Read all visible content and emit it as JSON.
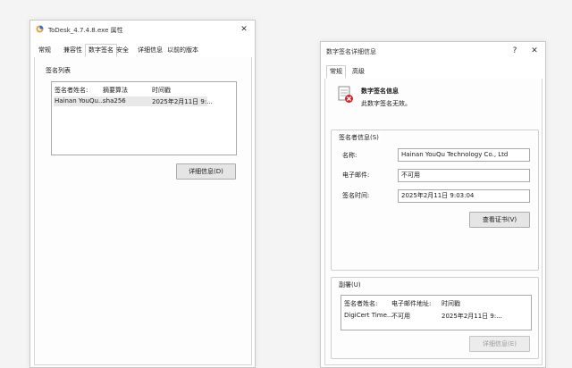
{
  "left_window": {
    "title": "ToDesk_4.7.4.8.exe 属性",
    "close_glyph": "✕",
    "tabs": [
      "常规",
      "兼容性",
      "数字签名",
      "安全",
      "详细信息",
      "以前的版本"
    ],
    "active_tab": "数字签名",
    "signature_list": {
      "label": "签名列表",
      "columns": [
        "签名者姓名:",
        "摘要算法",
        "时间戳"
      ],
      "rows": [
        {
          "name": "Hainan YouQu...",
          "digest": "sha256",
          "timestamp": "2025年2月11日 9:..."
        }
      ]
    },
    "details_button": "详细信息(D)"
  },
  "right_window": {
    "title": "数字签名详细信息",
    "help_glyph": "?",
    "close_glyph": "✕",
    "tabs": [
      "常规",
      "高级"
    ],
    "active_tab": "常规",
    "info_title": "数字签名信息",
    "info_status": "此数字签名无效。",
    "signer_info": {
      "label": "签名者信息(S)",
      "name_label": "名称:",
      "name_value": "Hainan YouQu Technology Co., Ltd",
      "email_label": "电子邮件:",
      "email_value": "不可用",
      "time_label": "签名时间:",
      "time_value": "2025年2月11日 9:03:04",
      "view_cert_button": "查看证书(V)"
    },
    "countersign": {
      "label": "副署(U)",
      "columns": [
        "签名者姓名:",
        "电子邮件地址:",
        "时间戳"
      ],
      "rows": [
        {
          "name": "DigiCert Time...",
          "email": "不可用",
          "timestamp": "2025年2月11日 9:..."
        }
      ],
      "details_button": "详细信息(E)"
    }
  },
  "colors": {
    "accent_icon_red": "#c8262b",
    "selection_gray": "#e8e8e8"
  }
}
